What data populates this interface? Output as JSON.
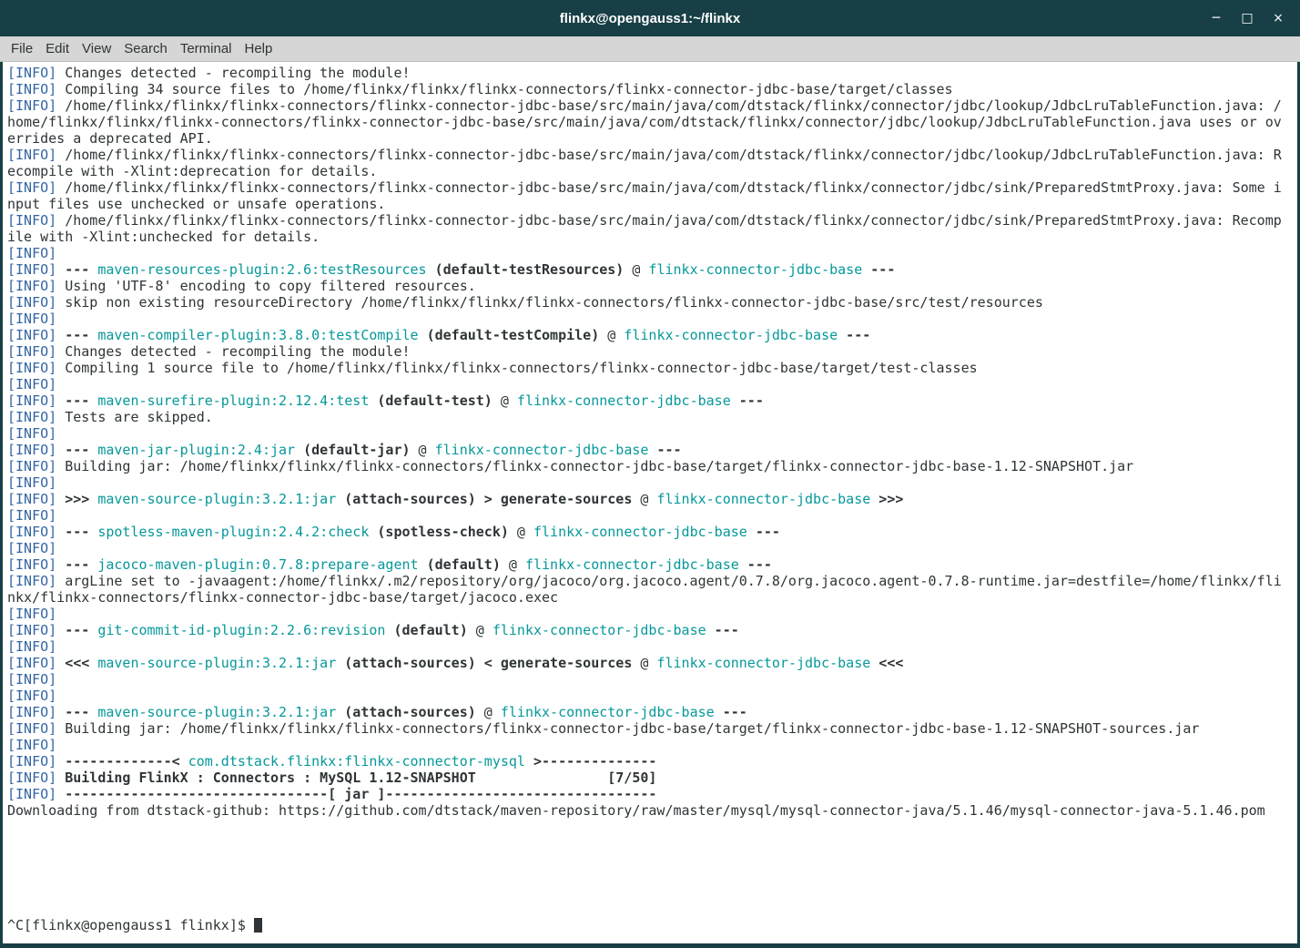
{
  "window": {
    "title": "flinkx@opengauss1:~/flinkx",
    "controls": {
      "minimize": "─",
      "maximize": "□",
      "close": "×"
    }
  },
  "menu": {
    "items": [
      "File",
      "Edit",
      "View",
      "Search",
      "Terminal",
      "Help"
    ]
  },
  "colors": {
    "frame": "#173f45",
    "titlebar_text": "#ffffff",
    "menubar_bg": "#d6d6d6",
    "menubar_fg": "#2e3436",
    "terminal_bg": "#ffffff",
    "terminal_fg": "#2e3436",
    "info_blue": "#3465a4",
    "maven_cyan": "#06989a",
    "cursor": "#2e3436"
  },
  "terminal": {
    "columns": 155,
    "prompt": "^C[flinkx@opengauss1 flinkx]$ ",
    "lines": [
      [
        {
          "t": "[INFO]",
          "s": "info"
        },
        {
          "t": " Changes detected - recompiling the module!"
        }
      ],
      [
        {
          "t": "[INFO]",
          "s": "info"
        },
        {
          "t": " Compiling 34 source files to /home/flinkx/flinkx/flinkx-connectors/flinkx-connector-jdbc-base/target/classes"
        }
      ],
      [
        {
          "t": "[INFO]",
          "s": "info"
        },
        {
          "t": " /home/flinkx/flinkx/flinkx-connectors/flinkx-connector-jdbc-base/src/main/java/com/dtstack/flinkx/connector/jdbc/lookup/JdbcLruTableFunction.java: /home/flinkx/flinkx/flinkx-connectors/flinkx-connector-jdbc-base/src/main/java/com/dtstack/flinkx/connector/jdbc/lookup/JdbcLruTableFunction.java uses or overrides a deprecated API."
        }
      ],
      [
        {
          "t": "[INFO]",
          "s": "info"
        },
        {
          "t": " /home/flinkx/flinkx/flinkx-connectors/flinkx-connector-jdbc-base/src/main/java/com/dtstack/flinkx/connector/jdbc/lookup/JdbcLruTableFunction.java: Recompile with -Xlint:deprecation for details."
        }
      ],
      [
        {
          "t": "[INFO]",
          "s": "info"
        },
        {
          "t": " /home/flinkx/flinkx/flinkx-connectors/flinkx-connector-jdbc-base/src/main/java/com/dtstack/flinkx/connector/jdbc/sink/PreparedStmtProxy.java: Some input files use unchecked or unsafe operations."
        }
      ],
      [
        {
          "t": "[INFO]",
          "s": "info"
        },
        {
          "t": " /home/flinkx/flinkx/flinkx-connectors/flinkx-connector-jdbc-base/src/main/java/com/dtstack/flinkx/connector/jdbc/sink/PreparedStmtProxy.java: Recompile with -Xlint:unchecked for details."
        }
      ],
      [
        {
          "t": "[INFO]",
          "s": "info"
        }
      ],
      [
        {
          "t": "[INFO]",
          "s": "info"
        },
        {
          "t": " "
        },
        {
          "t": "--- ",
          "s": "b"
        },
        {
          "t": "maven-resources-plugin:2.6:testResources",
          "s": "cyan"
        },
        {
          "t": " "
        },
        {
          "t": "(default-testResources)",
          "s": "b"
        },
        {
          "t": " @ "
        },
        {
          "t": "flinkx-connector-jdbc-base",
          "s": "cyan"
        },
        {
          "t": " ---",
          "s": "b"
        }
      ],
      [
        {
          "t": "[INFO]",
          "s": "info"
        },
        {
          "t": " Using 'UTF-8' encoding to copy filtered resources."
        }
      ],
      [
        {
          "t": "[INFO]",
          "s": "info"
        },
        {
          "t": " skip non existing resourceDirectory /home/flinkx/flinkx/flinkx-connectors/flinkx-connector-jdbc-base/src/test/resources"
        }
      ],
      [
        {
          "t": "[INFO]",
          "s": "info"
        }
      ],
      [
        {
          "t": "[INFO]",
          "s": "info"
        },
        {
          "t": " "
        },
        {
          "t": "--- ",
          "s": "b"
        },
        {
          "t": "maven-compiler-plugin:3.8.0:testCompile",
          "s": "cyan"
        },
        {
          "t": " "
        },
        {
          "t": "(default-testCompile)",
          "s": "b"
        },
        {
          "t": " @ "
        },
        {
          "t": "flinkx-connector-jdbc-base",
          "s": "cyan"
        },
        {
          "t": " ---",
          "s": "b"
        }
      ],
      [
        {
          "t": "[INFO]",
          "s": "info"
        },
        {
          "t": " Changes detected - recompiling the module!"
        }
      ],
      [
        {
          "t": "[INFO]",
          "s": "info"
        },
        {
          "t": " Compiling 1 source file to /home/flinkx/flinkx/flinkx-connectors/flinkx-connector-jdbc-base/target/test-classes"
        }
      ],
      [
        {
          "t": "[INFO]",
          "s": "info"
        }
      ],
      [
        {
          "t": "[INFO]",
          "s": "info"
        },
        {
          "t": " "
        },
        {
          "t": "--- ",
          "s": "b"
        },
        {
          "t": "maven-surefire-plugin:2.12.4:test",
          "s": "cyan"
        },
        {
          "t": " "
        },
        {
          "t": "(default-test)",
          "s": "b"
        },
        {
          "t": " @ "
        },
        {
          "t": "flinkx-connector-jdbc-base",
          "s": "cyan"
        },
        {
          "t": " ---",
          "s": "b"
        }
      ],
      [
        {
          "t": "[INFO]",
          "s": "info"
        },
        {
          "t": " Tests are skipped."
        }
      ],
      [
        {
          "t": "[INFO]",
          "s": "info"
        }
      ],
      [
        {
          "t": "[INFO]",
          "s": "info"
        },
        {
          "t": " "
        },
        {
          "t": "--- ",
          "s": "b"
        },
        {
          "t": "maven-jar-plugin:2.4:jar",
          "s": "cyan"
        },
        {
          "t": " "
        },
        {
          "t": "(default-jar)",
          "s": "b"
        },
        {
          "t": " @ "
        },
        {
          "t": "flinkx-connector-jdbc-base",
          "s": "cyan"
        },
        {
          "t": " ---",
          "s": "b"
        }
      ],
      [
        {
          "t": "[INFO]",
          "s": "info"
        },
        {
          "t": " Building jar: /home/flinkx/flinkx/flinkx-connectors/flinkx-connector-jdbc-base/target/flinkx-connector-jdbc-base-1.12-SNAPSHOT.jar"
        }
      ],
      [
        {
          "t": "[INFO]",
          "s": "info"
        }
      ],
      [
        {
          "t": "[INFO]",
          "s": "info"
        },
        {
          "t": " "
        },
        {
          "t": ">>> ",
          "s": "b"
        },
        {
          "t": "maven-source-plugin:3.2.1:jar",
          "s": "cyan"
        },
        {
          "t": " "
        },
        {
          "t": "(attach-sources)",
          "s": "b"
        },
        {
          "t": " > generate-sources",
          "s": "b"
        },
        {
          "t": " @ "
        },
        {
          "t": "flinkx-connector-jdbc-base",
          "s": "cyan"
        },
        {
          "t": " >>>",
          "s": "b"
        }
      ],
      [
        {
          "t": "[INFO]",
          "s": "info"
        }
      ],
      [
        {
          "t": "[INFO]",
          "s": "info"
        },
        {
          "t": " "
        },
        {
          "t": "--- ",
          "s": "b"
        },
        {
          "t": "spotless-maven-plugin:2.4.2:check",
          "s": "cyan"
        },
        {
          "t": " "
        },
        {
          "t": "(spotless-check)",
          "s": "b"
        },
        {
          "t": " @ "
        },
        {
          "t": "flinkx-connector-jdbc-base",
          "s": "cyan"
        },
        {
          "t": " ---",
          "s": "b"
        }
      ],
      [
        {
          "t": "[INFO]",
          "s": "info"
        }
      ],
      [
        {
          "t": "[INFO]",
          "s": "info"
        },
        {
          "t": " "
        },
        {
          "t": "--- ",
          "s": "b"
        },
        {
          "t": "jacoco-maven-plugin:0.7.8:prepare-agent",
          "s": "cyan"
        },
        {
          "t": " "
        },
        {
          "t": "(default)",
          "s": "b"
        },
        {
          "t": " @ "
        },
        {
          "t": "flinkx-connector-jdbc-base",
          "s": "cyan"
        },
        {
          "t": " ---",
          "s": "b"
        }
      ],
      [
        {
          "t": "[INFO]",
          "s": "info"
        },
        {
          "t": " argLine set to -javaagent:/home/flinkx/.m2/repository/org/jacoco/org.jacoco.agent/0.7.8/org.jacoco.agent-0.7.8-runtime.jar=destfile=/home/flinkx/flinkx/flinkx-connectors/flinkx-connector-jdbc-base/target/jacoco.exec"
        }
      ],
      [
        {
          "t": "[INFO]",
          "s": "info"
        }
      ],
      [
        {
          "t": "[INFO]",
          "s": "info"
        },
        {
          "t": " "
        },
        {
          "t": "--- ",
          "s": "b"
        },
        {
          "t": "git-commit-id-plugin:2.2.6:revision",
          "s": "cyan"
        },
        {
          "t": " "
        },
        {
          "t": "(default)",
          "s": "b"
        },
        {
          "t": " @ "
        },
        {
          "t": "flinkx-connector-jdbc-base",
          "s": "cyan"
        },
        {
          "t": " ---",
          "s": "b"
        }
      ],
      [
        {
          "t": "[INFO]",
          "s": "info"
        }
      ],
      [
        {
          "t": "[INFO]",
          "s": "info"
        },
        {
          "t": " "
        },
        {
          "t": "<<< ",
          "s": "b"
        },
        {
          "t": "maven-source-plugin:3.2.1:jar",
          "s": "cyan"
        },
        {
          "t": " "
        },
        {
          "t": "(attach-sources)",
          "s": "b"
        },
        {
          "t": " < generate-sources",
          "s": "b"
        },
        {
          "t": " @ "
        },
        {
          "t": "flinkx-connector-jdbc-base",
          "s": "cyan"
        },
        {
          "t": " <<<",
          "s": "b"
        }
      ],
      [
        {
          "t": "[INFO]",
          "s": "info"
        }
      ],
      [
        {
          "t": "[INFO]",
          "s": "info"
        }
      ],
      [
        {
          "t": "[INFO]",
          "s": "info"
        },
        {
          "t": " "
        },
        {
          "t": "--- ",
          "s": "b"
        },
        {
          "t": "maven-source-plugin:3.2.1:jar",
          "s": "cyan"
        },
        {
          "t": " "
        },
        {
          "t": "(attach-sources)",
          "s": "b"
        },
        {
          "t": " @ "
        },
        {
          "t": "flinkx-connector-jdbc-base",
          "s": "cyan"
        },
        {
          "t": " ---",
          "s": "b"
        }
      ],
      [
        {
          "t": "[INFO]",
          "s": "info"
        },
        {
          "t": " Building jar: /home/flinkx/flinkx/flinkx-connectors/flinkx-connector-jdbc-base/target/flinkx-connector-jdbc-base-1.12-SNAPSHOT-sources.jar"
        }
      ],
      [
        {
          "t": "[INFO]",
          "s": "info"
        }
      ],
      [
        {
          "t": "[INFO]",
          "s": "info"
        },
        {
          "t": " "
        },
        {
          "t": "-------------< ",
          "s": "b"
        },
        {
          "t": "com.dtstack.flinkx:flinkx-connector-mysql",
          "s": "cyan"
        },
        {
          "t": " >--------------",
          "s": "b"
        }
      ],
      [
        {
          "t": "[INFO]",
          "s": "info"
        },
        {
          "t": " "
        },
        {
          "t": "Building FlinkX : Connectors : MySQL 1.12-SNAPSHOT                [7/50]",
          "s": "b"
        }
      ],
      [
        {
          "t": "[INFO]",
          "s": "info"
        },
        {
          "t": " "
        },
        {
          "t": "--------------------------------[ jar ]---------------------------------",
          "s": "b"
        }
      ],
      [
        {
          "t": "Downloading from dtstack-github: https://github.com/dtstack/maven-repository/raw/master/mysql/mysql-connector-java/5.1.46/mysql-connector-java-5.1.46.pom"
        }
      ],
      [],
      [],
      [],
      [],
      [],
      []
    ]
  }
}
